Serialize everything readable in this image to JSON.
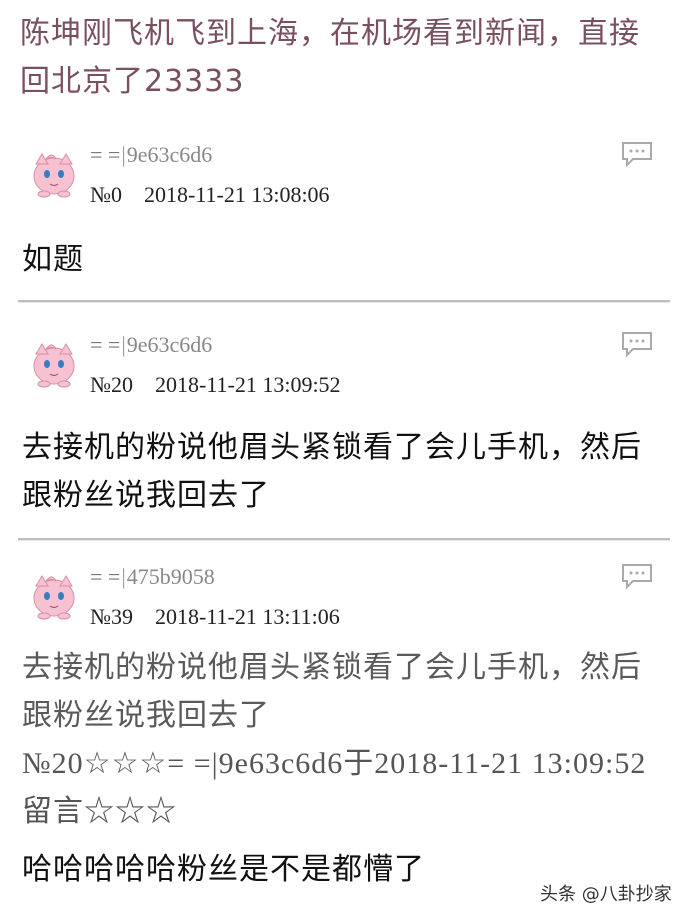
{
  "thread": {
    "title": "陈坤刚飞机飞到上海，在机场看到新闻，直接回北京了23333"
  },
  "posts": [
    {
      "user_prefix": "= =",
      "user_id": "9e63c6d6",
      "number": "№0",
      "timestamp": "2018-11-21 13:08:06",
      "body": "如题"
    },
    {
      "user_prefix": "= =",
      "user_id": "9e63c6d6",
      "number": "№20",
      "timestamp": "2018-11-21 13:09:52",
      "body": "去接机的粉说他眉头紧锁看了会儿手机，然后跟粉丝说我回去了"
    },
    {
      "user_prefix": "= =",
      "user_id": "475b9058",
      "number": "№39",
      "timestamp": "2018-11-21 13:11:06",
      "quoted_body": "去接机的粉说他眉头紧锁看了会儿手机，然后跟粉丝说我回去了",
      "quote_ref": "№20☆☆☆= =|9e63c6d6于2018-11-21 13:09:52留言☆☆☆",
      "body": "哈哈哈哈哈粉丝是不是都懵了"
    }
  ],
  "watermark": {
    "text": "头条 @八卦抄家"
  },
  "colors": {
    "title": "#7a4f62",
    "divider": "#bdbdbd",
    "avatar_pink": "#f3b6c8"
  }
}
